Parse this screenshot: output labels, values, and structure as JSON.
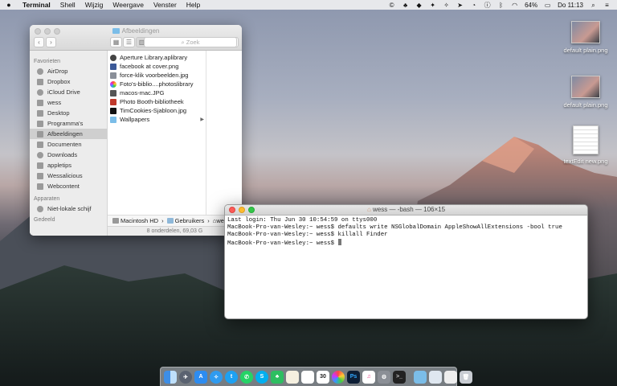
{
  "menubar": {
    "apple_icon": "apple-icon",
    "items": [
      "Terminal",
      "Shell",
      "Wijzig",
      "Weergave",
      "Venster",
      "Help"
    ],
    "battery": "64%",
    "clock": "Do 11:13"
  },
  "desktop_icons": [
    {
      "label": "default plain.png"
    },
    {
      "label": "default plain.png"
    },
    {
      "label": "textEdit new.png"
    }
  ],
  "finder": {
    "title": "Afbeeldingen",
    "search_placeholder": "Zoek",
    "sidebar": {
      "favorites_header": "Favorieten",
      "favorites": [
        "AirDrop",
        "Dropbox",
        "iCloud Drive",
        "wess",
        "Desktop",
        "Programma's",
        "Afbeeldingen",
        "Documenten",
        "Downloads",
        "appletips",
        "Wessalicious",
        "Webcontent"
      ],
      "devices_header": "Apparaten",
      "devices": [
        "Niet-lokale schijf"
      ],
      "shared_header": "Gedeeld"
    },
    "files": [
      "Aperture Library.aplibrary",
      "facebook at cover.png",
      "force-klik voorbeelden.jpg",
      "Foto's-biblio....photoslibrary",
      "macos-mac.JPG",
      "Photo Booth-bibliotheek",
      "TimCookies-Sjabloon.jpg",
      "Wallpapers"
    ],
    "path": [
      "Macintosh HD",
      "Gebruikers",
      "we"
    ],
    "status": "8 onderdelen, 69,03 G"
  },
  "terminal": {
    "title": "wess — -bash — 106×15",
    "lines": [
      "Last login: Thu Jun 30 10:54:59 on ttys000",
      "MacBook-Pro-van-Wesley:~ wess$ defaults write NSGlobalDomain AppleShowAllExtensions -bool true",
      "MacBook-Pro-van-Wesley:~ wess$ killall Finder",
      "MacBook-Pro-van-Wesley:~ wess$ "
    ]
  },
  "dock": {
    "calendar_day": "30"
  }
}
